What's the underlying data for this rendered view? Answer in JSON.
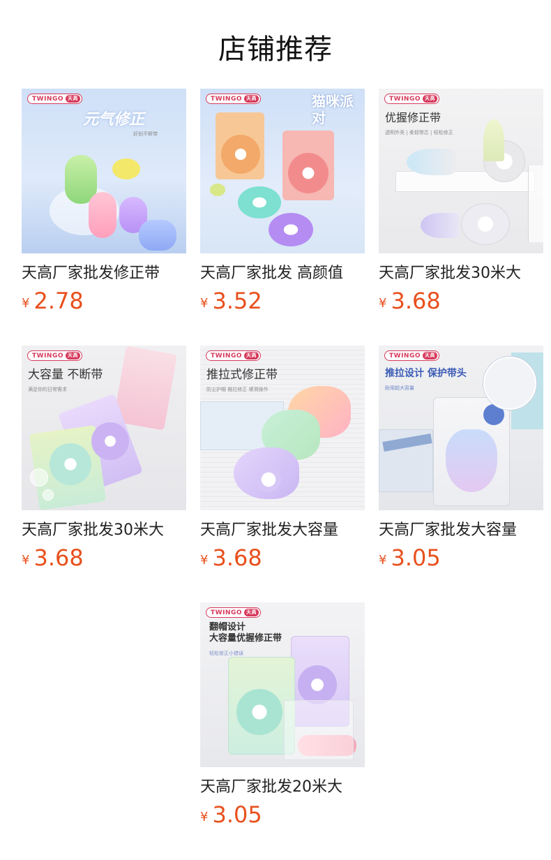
{
  "page_title": "店铺推荐",
  "currency": "¥",
  "products": [
    {
      "name": "天高厂家批发修正带",
      "price": "2.78",
      "brand": "TWINGO",
      "brand_badge": "天高",
      "overlay": "元气修正",
      "overlay_sub": "好划不断带"
    },
    {
      "name": "天高厂家批发 高颜值",
      "price": "3.52",
      "brand": "TWINGO",
      "brand_badge": "天高",
      "overlay": "猫咪派对",
      "overlay_sub": ""
    },
    {
      "name": "天高厂家批发30米大",
      "price": "3.68",
      "brand": "TWINGO",
      "brand_badge": "天高",
      "overlay": "优握修正带",
      "overlay_sub": "透明外壳 | 柔韧带芯 | 轻松修正"
    },
    {
      "name": "天高厂家批发30米大",
      "price": "3.68",
      "brand": "TWINGO",
      "brand_badge": "天高",
      "overlay": "大容量 不断带",
      "overlay_sub": "满足你的日常需求"
    },
    {
      "name": "天高厂家批发大容量",
      "price": "3.68",
      "brand": "TWINGO",
      "brand_badge": "天高",
      "overlay": "推拉式修正带",
      "overlay_sub": "防尘护帽 推拉修正 顺滑操作"
    },
    {
      "name": "天高厂家批发大容量",
      "price": "3.05",
      "brand": "TWINGO",
      "brand_badge": "天高",
      "overlay": "推拉设计 保护带头",
      "overlay_sub": "耐用超大容量"
    },
    {
      "name": "天高厂家批发20米大",
      "price": "3.05",
      "brand": "TWINGO",
      "brand_badge": "天高",
      "overlay": "翻帽设计\n大容量优握修正带",
      "overlay_sub": "轻松修正小错误"
    }
  ]
}
